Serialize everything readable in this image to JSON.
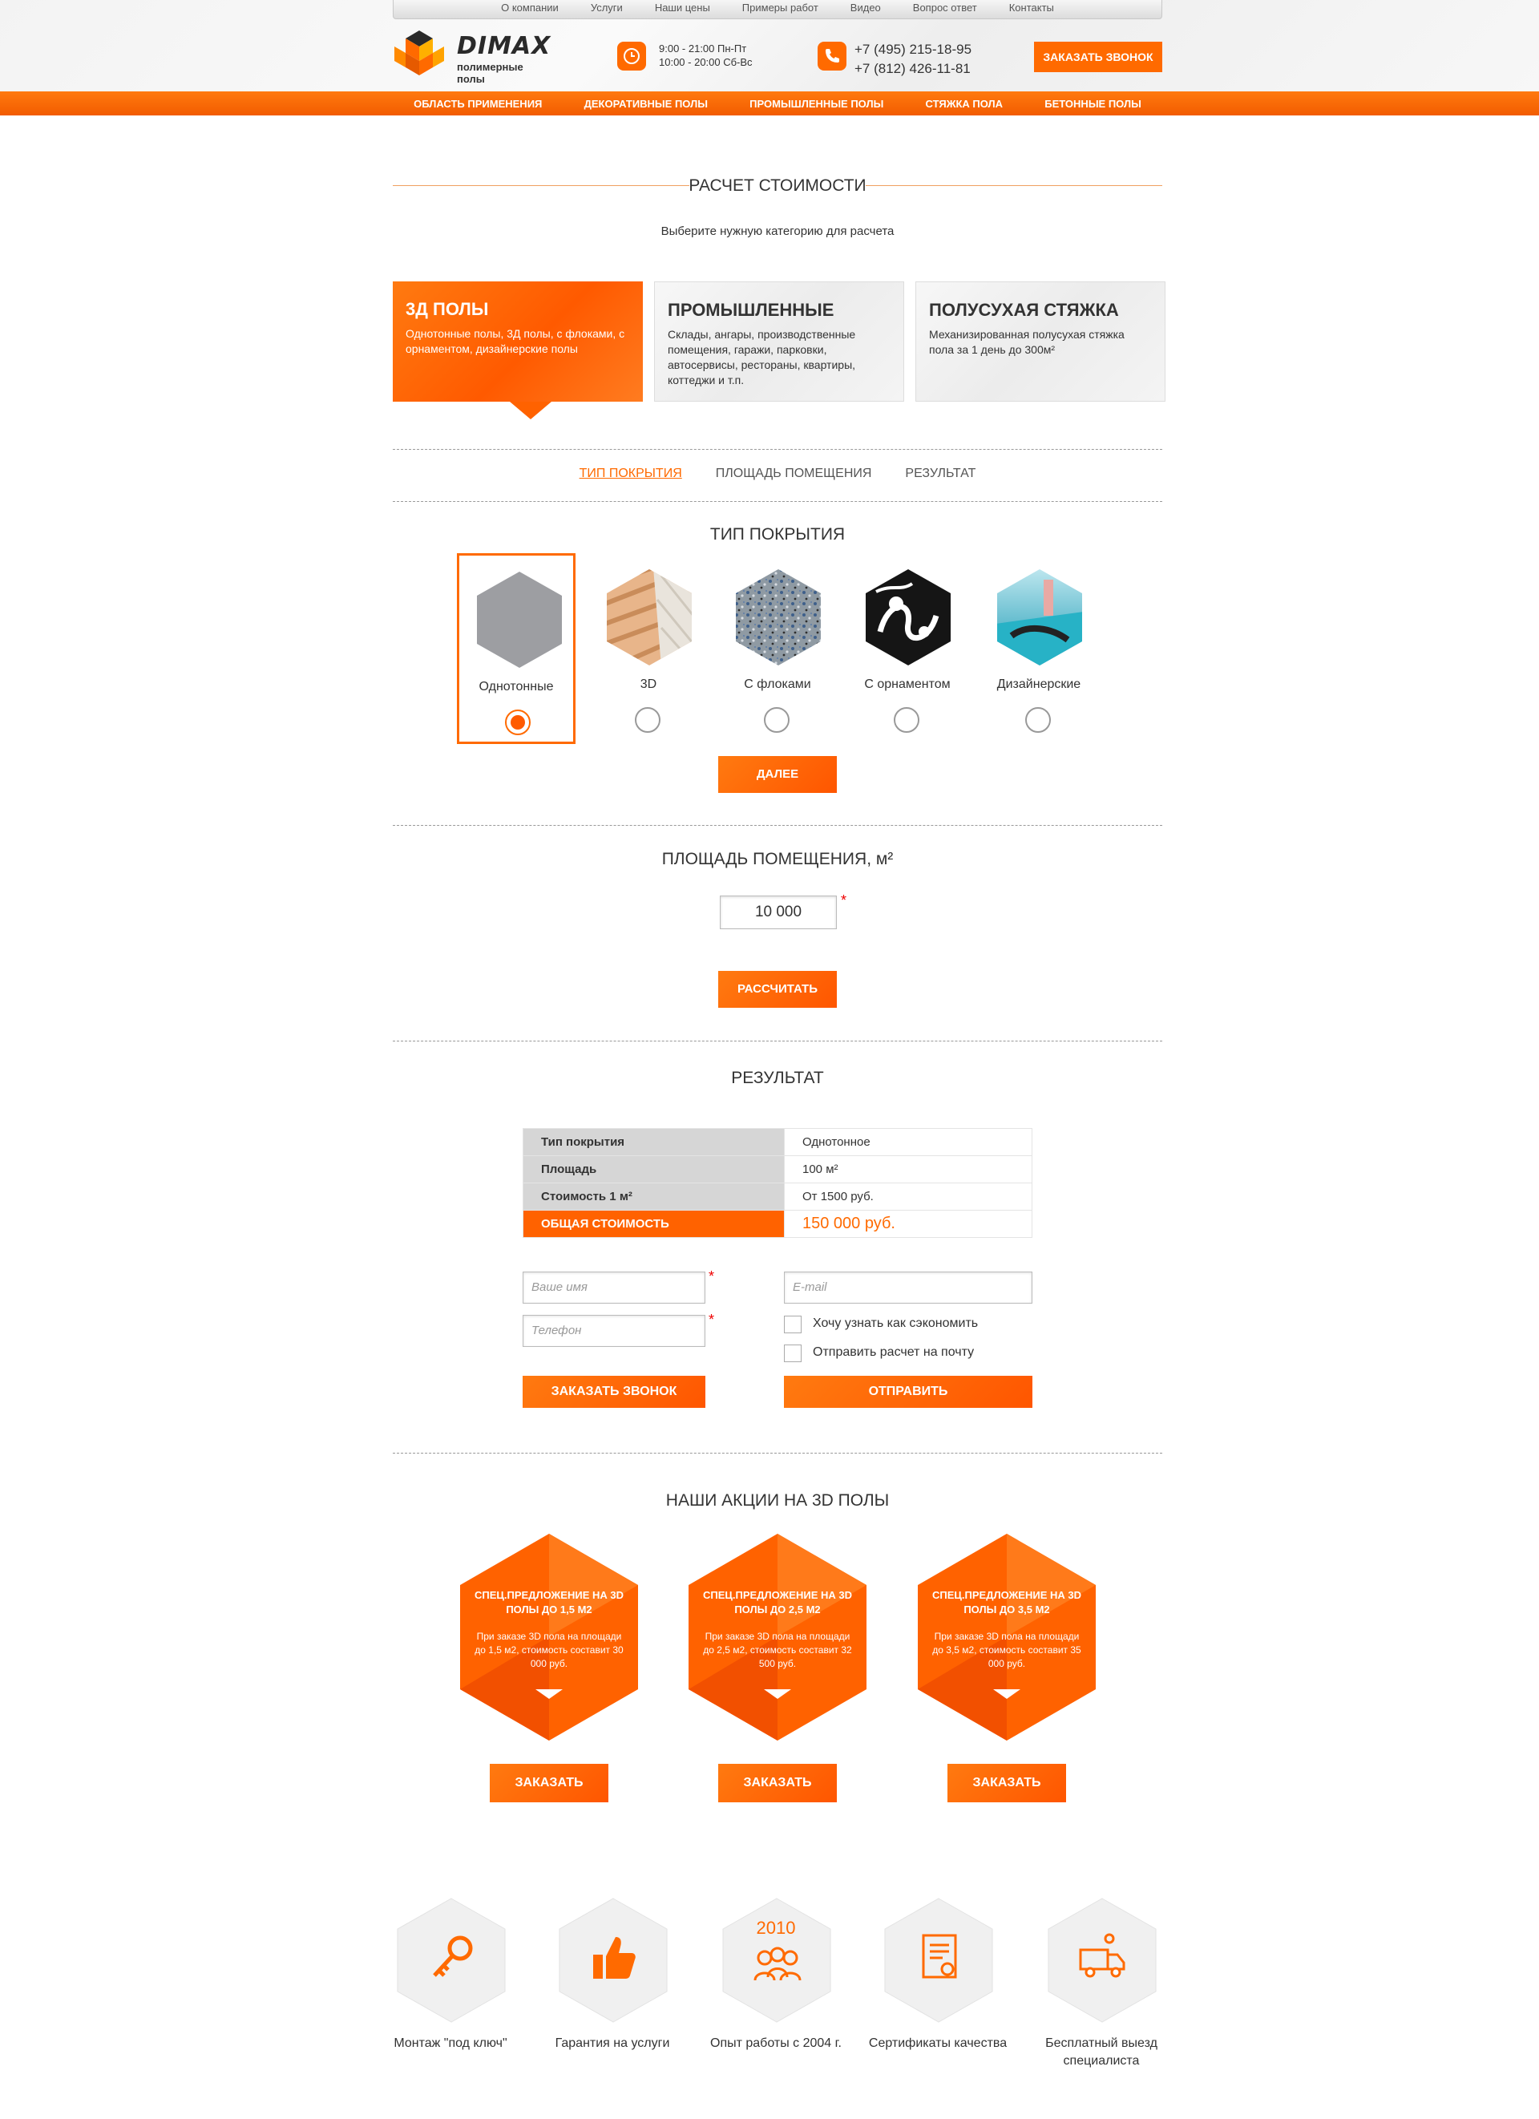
{
  "top_nav": [
    "О компании",
    "Услуги",
    "Наши цены",
    "Примеры работ",
    "Видео",
    "Вопрос ответ",
    "Контакты"
  ],
  "brand": {
    "name": "DIMAX",
    "tagline": "полимерные полы"
  },
  "hours": {
    "weekdays": "9:00 - 21:00 Пн-Пт",
    "weekend": "10:00 - 20:00 Сб-Вс"
  },
  "phones": [
    "+7 (495) 215-18-95",
    "+7 (812) 426-11-81"
  ],
  "callback_label": "ЗАКАЗАТЬ ЗВОНОК",
  "main_nav": [
    "ОБЛАСТЬ ПРИМЕНЕНИЯ",
    "ДЕКОРАТИВНЫЕ ПОЛЫ",
    "ПРОМЫШЛЕННЫЕ ПОЛЫ",
    "СТЯЖКА ПОЛА",
    "БЕТОННЫЕ ПОЛЫ"
  ],
  "calc": {
    "title": "РАСЧЕТ СТОИМОСТИ",
    "hint": "Выберите нужную категорию для расчета",
    "categories": [
      {
        "title": "3Д ПОЛЫ",
        "desc": "Однотонные полы, 3Д полы, с флоками, с орнаментом, дизайнерские полы",
        "active": true
      },
      {
        "title": "ПРОМЫШЛЕННЫЕ",
        "desc": "Склады, ангары, производственные помещения, гаражи, парковки, автосервисы, рестораны, квартиры, коттеджи и т.п.",
        "active": false
      },
      {
        "title": "ПОЛУСУХАЯ СТЯЖКА",
        "desc": "Механизированная полусухая стяжка пола за 1 день до 300м²",
        "active": false
      }
    ],
    "tabs": [
      "ТИП ПОКРЫТИЯ",
      "ПЛОЩАДЬ ПОМЕЩЕНИЯ",
      "РЕЗУЛЬТАТ"
    ],
    "active_tab": 0
  },
  "coverage": {
    "title": "ТИП ПОКРЫТИЯ",
    "options": [
      {
        "label": "Однотонные",
        "selected": true
      },
      {
        "label": "3D",
        "selected": false
      },
      {
        "label": "С флоками",
        "selected": false
      },
      {
        "label": "С орнаментом",
        "selected": false
      },
      {
        "label": "Дизайнерские",
        "selected": false
      }
    ],
    "next_label": "ДАЛЕЕ"
  },
  "area": {
    "title": "ПЛОЩАДЬ ПОМЕЩЕНИЯ, м²",
    "value": "10 000",
    "required_mark": "*",
    "calc_label": "РАССЧИТАТЬ"
  },
  "result": {
    "title": "РЕЗУЛЬТАТ",
    "rows": [
      {
        "key": "Тип покрытия",
        "value": "Однотонное"
      },
      {
        "key": "Площадь",
        "value": "100 м²"
      },
      {
        "key": "Стоимость 1 м²",
        "value": "От 1500 руб."
      },
      {
        "key": "ОБЩАЯ СТОИМОСТЬ",
        "value": "150 000 руб."
      }
    ]
  },
  "form": {
    "name_placeholder": "Ваше имя",
    "phone_placeholder": "Телефон",
    "email_placeholder": "E-mail",
    "check_save": "Хочу узнать как сэкономить",
    "check_mail": "Отправить расчет на почту",
    "call_label": "ЗАКАЗАТЬ ЗВОНОК",
    "send_label": "ОТПРАВИТЬ"
  },
  "promos": {
    "title": "НАШИ АКЦИИ НА 3D ПОЛЫ",
    "items": [
      {
        "title": "СПЕЦ.ПРЕДЛОЖЕНИЕ НА 3D ПОЛЫ ДО 1,5 М2",
        "desc": "При заказе 3D пола на площади до 1,5 м2, стоимость составит 30 000 руб.",
        "button": "ЗАКАЗАТЬ"
      },
      {
        "title": "СПЕЦ.ПРЕДЛОЖЕНИЕ НА 3D ПОЛЫ ДО 2,5 М2",
        "desc": "При заказе 3D пола на площади до 2,5 м2, стоимость составит 32 500 руб.",
        "button": "ЗАКАЗАТЬ"
      },
      {
        "title": "СПЕЦ.ПРЕДЛОЖЕНИЕ НА 3D ПОЛЫ ДО 3,5 М2",
        "desc": "При заказе 3D пола на площади до 3,5 м2, стоимость составит 35 000 руб.",
        "button": "ЗАКАЗАТЬ"
      }
    ]
  },
  "features": [
    {
      "label": "Монтаж \"под ключ\"",
      "icon": "key-icon"
    },
    {
      "label": "Гарантия на услуги",
      "icon": "thumbs-up-icon"
    },
    {
      "label": "Опыт работы с 2004 г.",
      "icon": "team-icon",
      "year": "2010"
    },
    {
      "label": "Сертификаты качества",
      "icon": "certificate-icon"
    },
    {
      "label": "Бесплатный выезд специалиста",
      "icon": "truck-icon"
    }
  ],
  "colors": {
    "accent": "#ff6a00",
    "text": "#333333",
    "table_key_bg": "#d6d6d6"
  }
}
